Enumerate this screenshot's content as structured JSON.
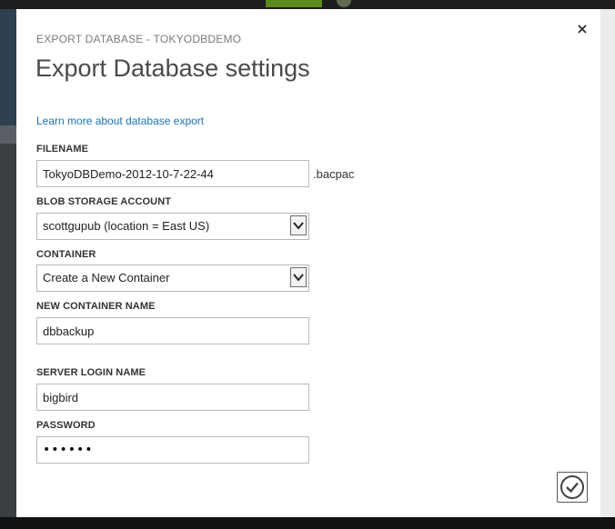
{
  "dialog": {
    "subtitle": "EXPORT DATABASE - TOKYODBDEMO",
    "title": "Export Database settings",
    "learn_more_link": "Learn more about database export",
    "close_glyph": "×"
  },
  "fields": {
    "filename": {
      "label": "FILENAME",
      "value": "TokyoDBDemo-2012-10-7-22-44",
      "suffix": ".bacpac"
    },
    "blob_storage": {
      "label": "BLOB STORAGE ACCOUNT",
      "value": "scottgupub (location = East US)"
    },
    "container": {
      "label": "CONTAINER",
      "value": "Create a New Container"
    },
    "new_container_name": {
      "label": "NEW CONTAINER NAME",
      "value": "dbbackup"
    },
    "server_login": {
      "label": "SERVER LOGIN NAME",
      "value": "bigbird"
    },
    "password": {
      "label": "PASSWORD",
      "masked": "••••••"
    }
  },
  "icons": {
    "close": "close-icon",
    "dropdown": "chevron-down-icon",
    "confirm": "checkmark-icon"
  },
  "colors": {
    "link": "#1a73b4",
    "title": "#4a4a4a",
    "border": "#b9b9b9"
  }
}
